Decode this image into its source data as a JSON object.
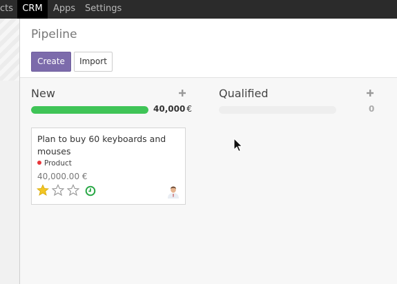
{
  "topbar": {
    "items": [
      {
        "label": "cts"
      },
      {
        "label": "CRM"
      },
      {
        "label": "Apps"
      },
      {
        "label": "Settings"
      }
    ]
  },
  "page": {
    "title": "Pipeline",
    "create_label": "Create",
    "import_label": "Import"
  },
  "kanban": {
    "columns": [
      {
        "title": "New",
        "add_icon": "plus-icon",
        "total": "40,000",
        "currency": "€",
        "progress": 1.0,
        "progress_color": "#3fc457",
        "cards": [
          {
            "title": "Plan to buy 60 keyboards and mouses",
            "tag": "Product",
            "tag_color": "#e8363a",
            "amount": "40,000.00 €",
            "priority_stars": 1,
            "max_stars": 3,
            "activity_icon": "clock-icon",
            "avatar_icon": "user-avatar-icon"
          }
        ]
      },
      {
        "title": "Qualified",
        "add_icon": "plus-icon",
        "total": "0",
        "progress": 0,
        "cards": []
      }
    ]
  },
  "colors": {
    "accent": "#7c6bab",
    "topbar": "#2b2b2b",
    "star_filled": "#f3c623",
    "activity_ok": "#28a745"
  }
}
